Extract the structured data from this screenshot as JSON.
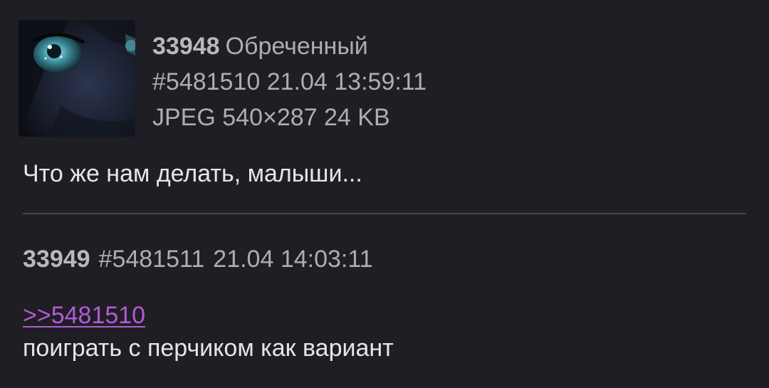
{
  "posts": [
    {
      "number": "33948",
      "name": "Обреченный",
      "id": "#5481510",
      "datetime": "21.04 13:59:11",
      "file_info": "JPEG 540×287 24 KB",
      "thumbnail": "anime-eye-thumbnail",
      "text": "Что же нам делать, малыши..."
    },
    {
      "number": "33949",
      "id": "#5481511",
      "datetime": "21.04 14:03:11",
      "reply_link": ">>5481510",
      "text": "поиграть с перчиком как вариант"
    }
  ],
  "colors": {
    "background": "#1f1e24",
    "link": "#b35ad6",
    "meta": "#aeaeae",
    "text": "#e6e6e6",
    "divider": "#46454b"
  }
}
